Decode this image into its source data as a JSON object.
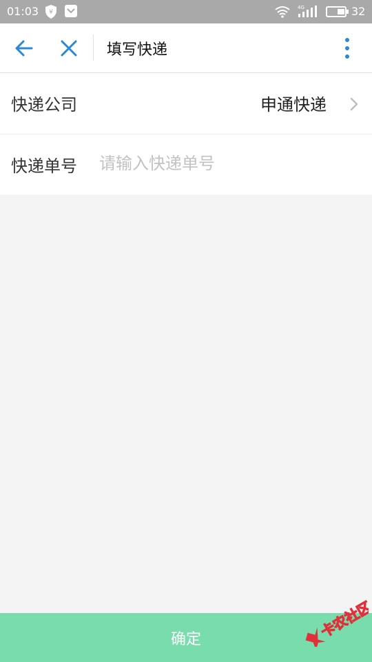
{
  "status_bar": {
    "time": "01:03",
    "network": "4G",
    "battery": "32"
  },
  "header": {
    "title": "填写快递",
    "icons": [
      "arrow-left-icon",
      "close-icon",
      "more-vertical-icon"
    ],
    "accent_color": "#2b88d8"
  },
  "form": {
    "company_label": "快递公司",
    "company_value": "申通快递",
    "tracking_label": "快递单号",
    "tracking_placeholder": "请输入快递单号",
    "tracking_value": ""
  },
  "footer": {
    "confirm_label": "确定",
    "confirm_color": "#78dcac"
  },
  "watermark": {
    "text": "卡农社区"
  }
}
